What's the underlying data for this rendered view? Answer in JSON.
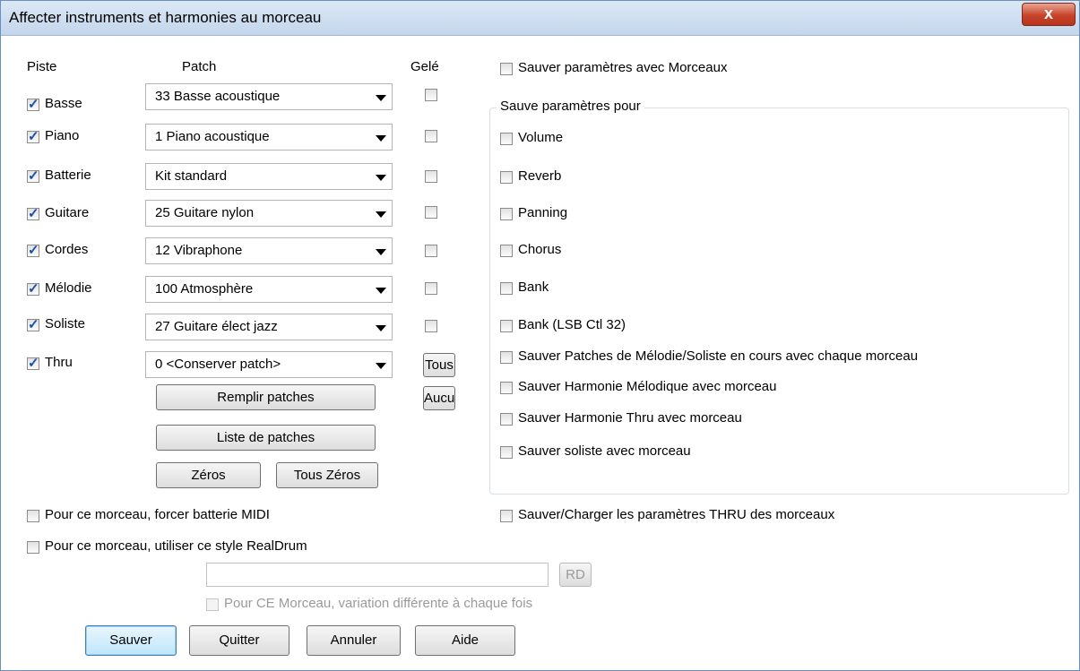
{
  "window": {
    "title": "Affecter instruments et harmonies au morceau",
    "close": "x"
  },
  "headers": {
    "piste": "Piste",
    "patch": "Patch",
    "gele": "Gelé"
  },
  "tracks": [
    {
      "name": "Basse",
      "checked": true,
      "patch": "33 Basse acoustique"
    },
    {
      "name": "Piano",
      "checked": true,
      "patch": "1 Piano acoustique"
    },
    {
      "name": "Batterie",
      "checked": true,
      "patch": "Kit standard"
    },
    {
      "name": "Guitare",
      "checked": true,
      "patch": "25 Guitare nylon"
    },
    {
      "name": "Cordes",
      "checked": true,
      "patch": "12 Vibraphone"
    },
    {
      "name": "Mélodie",
      "checked": true,
      "patch": "100 Atmosphère"
    },
    {
      "name": "Soliste",
      "checked": true,
      "patch": "27 Guitare élect jazz"
    },
    {
      "name": "Thru",
      "checked": true,
      "patch": "0 <Conserver patch>"
    }
  ],
  "buttons": {
    "remplir": "Remplir patches",
    "liste": "Liste de patches",
    "zeros": "Zéros",
    "tous_zeros": "Tous Zéros",
    "tous": "Tous",
    "aucun": "Aucur",
    "rd": "RD",
    "sauver": "Sauver",
    "quitter": "Quitter",
    "annuler": "Annuler",
    "aide": "Aide"
  },
  "save_with_songs": "Sauver paramètres avec Morceaux",
  "group_title": "Sauve paramètres pour",
  "save_options": [
    "Volume",
    "Reverb",
    "Panning",
    "Chorus",
    "Bank",
    "Bank (LSB Ctl 32)",
    "Sauver Patches de Mélodie/Soliste en cours avec chaque morceau",
    "Sauver Harmonie Mélodique avec morceau",
    "Sauver Harmonie Thru avec morceau",
    "Sauver soliste avec morceau"
  ],
  "thru_params": "Sauver/Charger les paramètres THRU des morceaux",
  "force_midi_drums": "Pour ce morceau, forcer batterie MIDI",
  "use_realdrum": "Pour ce morceau, utiliser ce style RealDrum",
  "realdrum_value": "",
  "variation": "Pour CE Morceau, variation différente à chaque fois"
}
